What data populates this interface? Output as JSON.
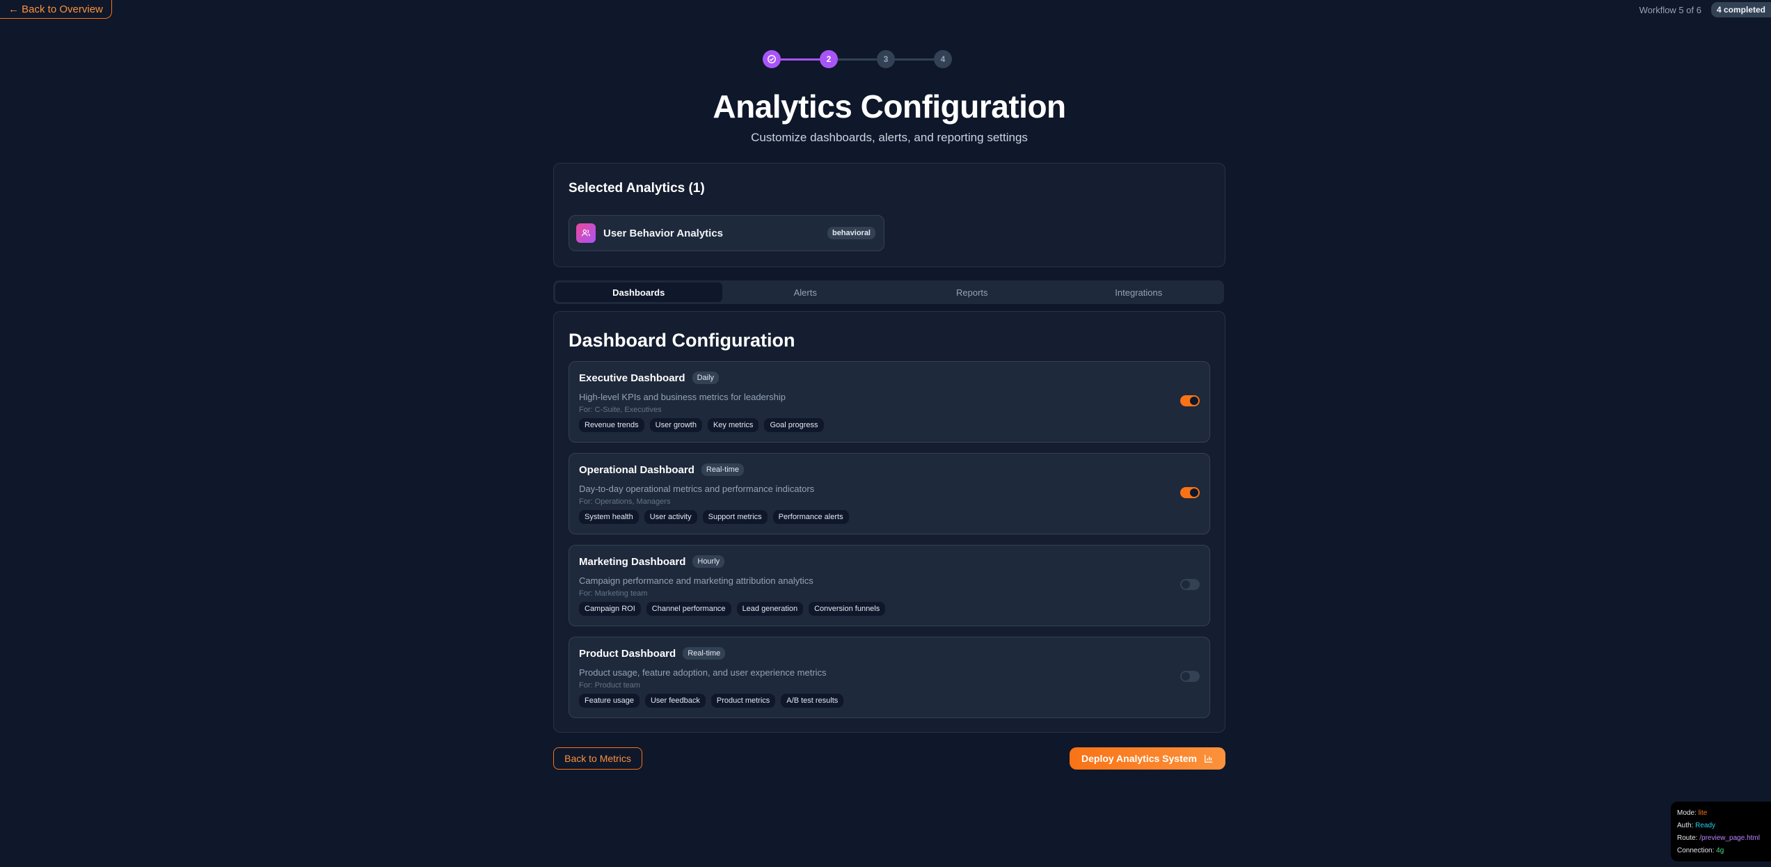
{
  "nav": {
    "back_label": "← Back to Overview"
  },
  "header": {
    "workflow_text": "Workflow 5 of 6",
    "completed_badge": "4 completed"
  },
  "stepper": {
    "steps": [
      "",
      "2",
      "3",
      "4"
    ]
  },
  "page": {
    "title": "Analytics Configuration",
    "subtitle": "Customize dashboards, alerts, and reporting settings"
  },
  "selected": {
    "heading": "Selected Analytics (1)",
    "item": {
      "name": "User Behavior Analytics",
      "tag": "behavioral",
      "icon": "users-icon"
    }
  },
  "tabs": [
    {
      "label": "Dashboards",
      "active": true
    },
    {
      "label": "Alerts",
      "active": false
    },
    {
      "label": "Reports",
      "active": false
    },
    {
      "label": "Integrations",
      "active": false
    }
  ],
  "config": {
    "heading": "Dashboard Configuration",
    "dashboards": [
      {
        "name": "Executive Dashboard",
        "frequency": "Daily",
        "description": "High-level KPIs and business metrics for leadership",
        "for": "For: C-Suite, Executives",
        "tags": [
          "Revenue trends",
          "User growth",
          "Key metrics",
          "Goal progress"
        ],
        "enabled": true
      },
      {
        "name": "Operational Dashboard",
        "frequency": "Real-time",
        "description": "Day-to-day operational metrics and performance indicators",
        "for": "For: Operations, Managers",
        "tags": [
          "System health",
          "User activity",
          "Support metrics",
          "Performance alerts"
        ],
        "enabled": true
      },
      {
        "name": "Marketing Dashboard",
        "frequency": "Hourly",
        "description": "Campaign performance and marketing attribution analytics",
        "for": "For: Marketing team",
        "tags": [
          "Campaign ROI",
          "Channel performance",
          "Lead generation",
          "Conversion funnels"
        ],
        "enabled": false
      },
      {
        "name": "Product Dashboard",
        "frequency": "Real-time",
        "description": "Product usage, feature adoption, and user experience metrics",
        "for": "For: Product team",
        "tags": [
          "Feature usage",
          "User feedback",
          "Product metrics",
          "A/B test results"
        ],
        "enabled": false
      }
    ]
  },
  "footer": {
    "back_label": "Back to Metrics",
    "deploy_label": "Deploy Analytics System"
  },
  "status": {
    "mode_label": "Mode:",
    "mode_value": "lite",
    "auth_label": "Auth:",
    "auth_value": "Ready",
    "route_label": "Route:",
    "route_value": "/preview_page.html",
    "conn_label": "Connection:",
    "conn_value": "4g"
  },
  "colors": {
    "accent": "#a855f7",
    "action": "#f97316",
    "background": "#0f172a"
  }
}
